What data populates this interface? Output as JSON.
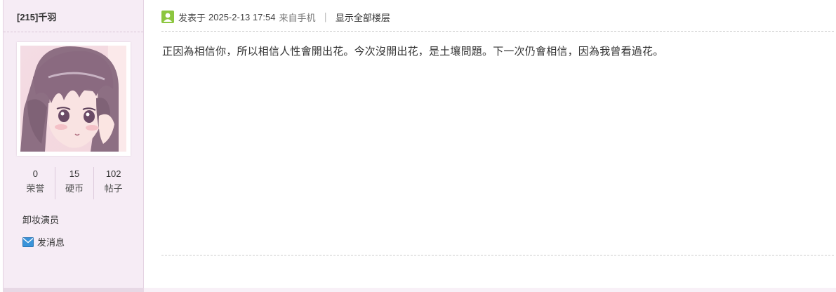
{
  "profile": {
    "username": "[215]千羽",
    "stats": [
      {
        "value": "0",
        "label": "荣誉"
      },
      {
        "value": "15",
        "label": "硬币"
      },
      {
        "value": "102",
        "label": "帖子"
      }
    ],
    "group": "卸妆演员",
    "send_message": "发消息",
    "avatar_icon": "anime-girl-avatar"
  },
  "post": {
    "posted_prefix": "发表于",
    "posted_time": "2025-2-13 17:54",
    "from_mobile": "来自手机",
    "separator": "|",
    "show_all_floors": "显示全部楼层",
    "content": "正因為相信你，所以相信人性會開出花。今次沒開出花，是土壤問題。下一次仍會相信，因為我曾看過花。"
  },
  "colors": {
    "sidebar_bg": "#f6ecf5",
    "user_icon_green": "#8cc63f",
    "mail_icon_blue": "#3a93d9"
  }
}
